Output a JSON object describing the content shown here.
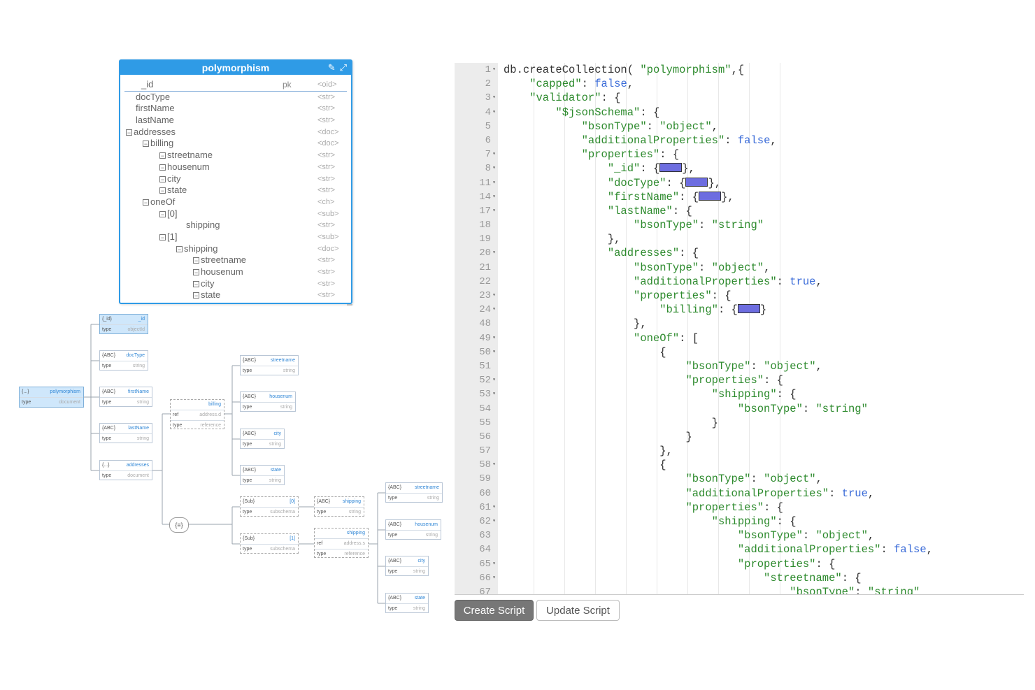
{
  "entity": {
    "title": "polymorphism",
    "icons": [
      "pencil-icon",
      "expand-icon"
    ],
    "rows": [
      {
        "name": "_id",
        "pk": "pk",
        "type": "<oid>",
        "indent": 0,
        "toggle": ""
      },
      {
        "name": "docType",
        "pk": "",
        "type": "<str>",
        "indent": 0,
        "toggle": ""
      },
      {
        "name": "firstName",
        "pk": "",
        "type": "<str>",
        "indent": 0,
        "toggle": ""
      },
      {
        "name": "lastName",
        "pk": "",
        "type": "<str>",
        "indent": 0,
        "toggle": ""
      },
      {
        "name": "addresses",
        "pk": "",
        "type": "<doc>",
        "indent": 0,
        "toggle": "−"
      },
      {
        "name": "billing",
        "pk": "",
        "type": "<doc>",
        "indent": 1,
        "toggle": "−"
      },
      {
        "name": "streetname",
        "pk": "",
        "type": "<str>",
        "indent": 2,
        "toggle": "−"
      },
      {
        "name": "housenum",
        "pk": "",
        "type": "<str>",
        "indent": 2,
        "toggle": "−"
      },
      {
        "name": "city",
        "pk": "",
        "type": "<str>",
        "indent": 2,
        "toggle": "−"
      },
      {
        "name": "state",
        "pk": "",
        "type": "<str>",
        "indent": 2,
        "toggle": "−"
      },
      {
        "name": "oneOf",
        "pk": "",
        "type": "<ch>",
        "indent": 1,
        "toggle": "−"
      },
      {
        "name": "[0]",
        "pk": "",
        "type": "<sub>",
        "indent": 2,
        "toggle": "−"
      },
      {
        "name": "shipping",
        "pk": "",
        "type": "<str>",
        "indent": 3,
        "toggle": ""
      },
      {
        "name": "[1]",
        "pk": "",
        "type": "<sub>",
        "indent": 2,
        "toggle": "−"
      },
      {
        "name": "shipping",
        "pk": "",
        "type": "<doc>",
        "indent": 3,
        "toggle": "−"
      },
      {
        "name": "streetname",
        "pk": "",
        "type": "<str>",
        "indent": 4,
        "toggle": "−"
      },
      {
        "name": "housenum",
        "pk": "",
        "type": "<str>",
        "indent": 4,
        "toggle": "−"
      },
      {
        "name": "city",
        "pk": "",
        "type": "<str>",
        "indent": 4,
        "toggle": "−"
      },
      {
        "name": "state",
        "pk": "",
        "type": "<str>",
        "indent": 4,
        "toggle": "−"
      }
    ]
  },
  "tree": {
    "root": {
      "tag": "{...}",
      "name": "polymorphism",
      "key": "type",
      "value": "document"
    },
    "nodes": [
      {
        "id": "n-id",
        "tag": "{_id}",
        "name": "_id",
        "key": "type",
        "value": "objectId"
      },
      {
        "id": "n-doctype",
        "tag": "{ABC}",
        "name": "docType",
        "key": "type",
        "value": "string"
      },
      {
        "id": "n-firstname",
        "tag": "{ABC}",
        "name": "firstName",
        "key": "type",
        "value": "string"
      },
      {
        "id": "n-lastname",
        "tag": "{ABC}",
        "name": "lastName",
        "key": "type",
        "value": "string"
      },
      {
        "id": "n-addresses",
        "tag": "{...}",
        "name": "addresses",
        "key": "type",
        "value": "document"
      },
      {
        "id": "n-billing",
        "tag": "",
        "name": "billing",
        "key": "ref",
        "value": "address.d",
        "key2": "type",
        "value2": "reference"
      },
      {
        "id": "n-streetname",
        "tag": "{ABC}",
        "name": "streetname",
        "key": "type",
        "value": "string"
      },
      {
        "id": "n-housenum",
        "tag": "{ABC}",
        "name": "housenum",
        "key": "type",
        "value": "string"
      },
      {
        "id": "n-city",
        "tag": "{ABC}",
        "name": "city",
        "key": "type",
        "value": "string"
      },
      {
        "id": "n-state",
        "tag": "{ABC}",
        "name": "state",
        "key": "type",
        "value": "string"
      },
      {
        "id": "n-sub0",
        "tag": "{Sub}",
        "name": "[0]",
        "key": "type",
        "value": "subschema"
      },
      {
        "id": "n-sub1",
        "tag": "{Sub}",
        "name": "[1]",
        "key": "type",
        "value": "subschema"
      },
      {
        "id": "n-shipping-str",
        "tag": "{ABC}",
        "name": "shipping",
        "key": "type",
        "value": "string"
      },
      {
        "id": "n-shipping-ref",
        "tag": "",
        "name": "shipping",
        "key": "ref",
        "value": "address.s",
        "key2": "type",
        "value2": "reference"
      },
      {
        "id": "n-s-streetname",
        "tag": "{ABC}",
        "name": "streetname",
        "key": "type",
        "value": "string"
      },
      {
        "id": "n-s-housenum",
        "tag": "{ABC}",
        "name": "housenum",
        "key": "type",
        "value": "string"
      },
      {
        "id": "n-s-city",
        "tag": "{ABC}",
        "name": "city",
        "key": "type",
        "value": "string"
      },
      {
        "id": "n-s-state",
        "tag": "{ABC}",
        "name": "state",
        "key": "type",
        "value": "string"
      }
    ],
    "choice_label": "{≡}"
  },
  "editor": {
    "gutter": [
      {
        "n": "1",
        "fold": true
      },
      {
        "n": "2",
        "fold": false
      },
      {
        "n": "3",
        "fold": true
      },
      {
        "n": "4",
        "fold": true
      },
      {
        "n": "5",
        "fold": false
      },
      {
        "n": "6",
        "fold": false
      },
      {
        "n": "7",
        "fold": true
      },
      {
        "n": "8",
        "fold": true
      },
      {
        "n": "11",
        "fold": true
      },
      {
        "n": "14",
        "fold": true
      },
      {
        "n": "17",
        "fold": true
      },
      {
        "n": "18",
        "fold": false
      },
      {
        "n": "19",
        "fold": false
      },
      {
        "n": "20",
        "fold": true
      },
      {
        "n": "21",
        "fold": false
      },
      {
        "n": "22",
        "fold": false
      },
      {
        "n": "23",
        "fold": true
      },
      {
        "n": "24",
        "fold": true
      },
      {
        "n": "48",
        "fold": false
      },
      {
        "n": "49",
        "fold": true
      },
      {
        "n": "50",
        "fold": true
      },
      {
        "n": "51",
        "fold": false
      },
      {
        "n": "52",
        "fold": true
      },
      {
        "n": "53",
        "fold": true
      },
      {
        "n": "54",
        "fold": false
      },
      {
        "n": "55",
        "fold": false
      },
      {
        "n": "56",
        "fold": false
      },
      {
        "n": "57",
        "fold": false
      },
      {
        "n": "58",
        "fold": true
      },
      {
        "n": "59",
        "fold": false
      },
      {
        "n": "60",
        "fold": false
      },
      {
        "n": "61",
        "fold": true
      },
      {
        "n": "62",
        "fold": true
      },
      {
        "n": "63",
        "fold": false
      },
      {
        "n": "64",
        "fold": false
      },
      {
        "n": "65",
        "fold": true
      },
      {
        "n": "66",
        "fold": true
      },
      {
        "n": "67",
        "fold": false
      }
    ],
    "lines": [
      [
        {
          "c": "p",
          "t": "db.createCollection( "
        },
        {
          "c": "s",
          "t": "\"polymorphism\""
        },
        {
          "c": "p",
          "t": ",{"
        }
      ],
      [
        {
          "c": "s",
          "t": "    \"capped\""
        },
        {
          "c": "p",
          "t": ": "
        },
        {
          "c": "b",
          "t": "false"
        },
        {
          "c": "p",
          "t": ","
        }
      ],
      [
        {
          "c": "s",
          "t": "    \"validator\""
        },
        {
          "c": "p",
          "t": ": {"
        }
      ],
      [
        {
          "c": "s",
          "t": "        \"$jsonSchema\""
        },
        {
          "c": "p",
          "t": ": {"
        }
      ],
      [
        {
          "c": "s",
          "t": "            \"bsonType\""
        },
        {
          "c": "p",
          "t": ": "
        },
        {
          "c": "s",
          "t": "\"object\""
        },
        {
          "c": "p",
          "t": ","
        }
      ],
      [
        {
          "c": "s",
          "t": "            \"additionalProperties\""
        },
        {
          "c": "p",
          "t": ": "
        },
        {
          "c": "b",
          "t": "false"
        },
        {
          "c": "p",
          "t": ","
        }
      ],
      [
        {
          "c": "s",
          "t": "            \"properties\""
        },
        {
          "c": "p",
          "t": ": {"
        }
      ],
      [
        {
          "c": "s",
          "t": "                \"_id\""
        },
        {
          "c": "p",
          "t": ": {"
        },
        {
          "c": "fw",
          "t": ""
        },
        {
          "c": "p",
          "t": "},"
        }
      ],
      [
        {
          "c": "s",
          "t": "                \"docType\""
        },
        {
          "c": "p",
          "t": ": {"
        },
        {
          "c": "fw",
          "t": ""
        },
        {
          "c": "p",
          "t": "},"
        }
      ],
      [
        {
          "c": "s",
          "t": "                \"firstName\""
        },
        {
          "c": "p",
          "t": ": {"
        },
        {
          "c": "fw",
          "t": ""
        },
        {
          "c": "p",
          "t": "},"
        }
      ],
      [
        {
          "c": "s",
          "t": "                \"lastName\""
        },
        {
          "c": "p",
          "t": ": {"
        }
      ],
      [
        {
          "c": "s",
          "t": "                    \"bsonType\""
        },
        {
          "c": "p",
          "t": ": "
        },
        {
          "c": "s",
          "t": "\"string\""
        }
      ],
      [
        {
          "c": "p",
          "t": "                },"
        }
      ],
      [
        {
          "c": "s",
          "t": "                \"addresses\""
        },
        {
          "c": "p",
          "t": ": {"
        }
      ],
      [
        {
          "c": "s",
          "t": "                    \"bsonType\""
        },
        {
          "c": "p",
          "t": ": "
        },
        {
          "c": "s",
          "t": "\"object\""
        },
        {
          "c": "p",
          "t": ","
        }
      ],
      [
        {
          "c": "s",
          "t": "                    \"additionalProperties\""
        },
        {
          "c": "p",
          "t": ": "
        },
        {
          "c": "b",
          "t": "true"
        },
        {
          "c": "p",
          "t": ","
        }
      ],
      [
        {
          "c": "s",
          "t": "                    \"properties\""
        },
        {
          "c": "p",
          "t": ": {"
        }
      ],
      [
        {
          "c": "s",
          "t": "                        \"billing\""
        },
        {
          "c": "p",
          "t": ": {"
        },
        {
          "c": "fw",
          "t": ""
        },
        {
          "c": "p",
          "t": "}"
        }
      ],
      [
        {
          "c": "p",
          "t": "                    },"
        }
      ],
      [
        {
          "c": "s",
          "t": "                    \"oneOf\""
        },
        {
          "c": "p",
          "t": ": ["
        }
      ],
      [
        {
          "c": "p",
          "t": "                        {"
        }
      ],
      [
        {
          "c": "s",
          "t": "                            \"bsonType\""
        },
        {
          "c": "p",
          "t": ": "
        },
        {
          "c": "s",
          "t": "\"object\""
        },
        {
          "c": "p",
          "t": ","
        }
      ],
      [
        {
          "c": "s",
          "t": "                            \"properties\""
        },
        {
          "c": "p",
          "t": ": {"
        }
      ],
      [
        {
          "c": "s",
          "t": "                                \"shipping\""
        },
        {
          "c": "p",
          "t": ": {"
        }
      ],
      [
        {
          "c": "s",
          "t": "                                    \"bsonType\""
        },
        {
          "c": "p",
          "t": ": "
        },
        {
          "c": "s",
          "t": "\"string\""
        }
      ],
      [
        {
          "c": "p",
          "t": "                                }"
        }
      ],
      [
        {
          "c": "p",
          "t": "                            }"
        }
      ],
      [
        {
          "c": "p",
          "t": "                        },"
        }
      ],
      [
        {
          "c": "p",
          "t": "                        {"
        }
      ],
      [
        {
          "c": "s",
          "t": "                            \"bsonType\""
        },
        {
          "c": "p",
          "t": ": "
        },
        {
          "c": "s",
          "t": "\"object\""
        },
        {
          "c": "p",
          "t": ","
        }
      ],
      [
        {
          "c": "s",
          "t": "                            \"additionalProperties\""
        },
        {
          "c": "p",
          "t": ": "
        },
        {
          "c": "b",
          "t": "true"
        },
        {
          "c": "p",
          "t": ","
        }
      ],
      [
        {
          "c": "s",
          "t": "                            \"properties\""
        },
        {
          "c": "p",
          "t": ": {"
        }
      ],
      [
        {
          "c": "s",
          "t": "                                \"shipping\""
        },
        {
          "c": "p",
          "t": ": {"
        }
      ],
      [
        {
          "c": "s",
          "t": "                                    \"bsonType\""
        },
        {
          "c": "p",
          "t": ": "
        },
        {
          "c": "s",
          "t": "\"object\""
        },
        {
          "c": "p",
          "t": ","
        }
      ],
      [
        {
          "c": "s",
          "t": "                                    \"additionalProperties\""
        },
        {
          "c": "p",
          "t": ": "
        },
        {
          "c": "b",
          "t": "false"
        },
        {
          "c": "p",
          "t": ","
        }
      ],
      [
        {
          "c": "s",
          "t": "                                    \"properties\""
        },
        {
          "c": "p",
          "t": ": {"
        }
      ],
      [
        {
          "c": "s",
          "t": "                                        \"streetname\""
        },
        {
          "c": "p",
          "t": ": {"
        }
      ],
      [
        {
          "c": "s",
          "t": "                                            \"bsonType\""
        },
        {
          "c": "p",
          "t": ": "
        },
        {
          "c": "s",
          "t": "\"string\""
        }
      ]
    ]
  },
  "buttons": {
    "create": "Create Script",
    "update": "Update Script"
  },
  "colors": {
    "accent": "#2f9be6",
    "string": "#2d8a2d",
    "keyword": "#3a6bd8"
  }
}
